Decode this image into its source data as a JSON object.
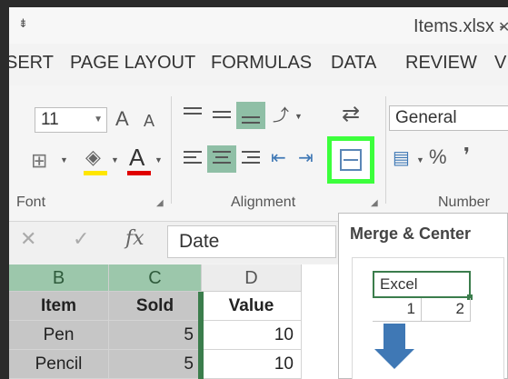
{
  "window": {
    "qat_glyph": "⇟",
    "title": "Items.xlsx - E",
    "close_glyph": "✕"
  },
  "tabs": [
    "SERT",
    "PAGE LAYOUT",
    "FORMULAS",
    "DATA",
    "REVIEW",
    "V"
  ],
  "font_group": {
    "size_value": "11",
    "increase_glyph": "A",
    "decrease_glyph": "A",
    "label": "Font",
    "fill_glyph": "◈",
    "font_color_glyph": "A",
    "highlight_color": "#ffe600",
    "font_color": "#e00000"
  },
  "alignment_group": {
    "label": "Alignment"
  },
  "number_group": {
    "format_value": "General",
    "percent_glyph": "%",
    "comma_glyph": "❜",
    "label": "Number"
  },
  "formula_bar": {
    "cancel_glyph": "✕",
    "enter_glyph": "✓",
    "fx_glyph": "fx",
    "value": "Date"
  },
  "grid": {
    "columns": [
      "B",
      "C",
      "D"
    ],
    "rows": [
      [
        "Item",
        "Sold",
        "Value"
      ],
      [
        "Pen",
        "5",
        "10"
      ],
      [
        "Pencil",
        "5",
        "10"
      ]
    ]
  },
  "tooltip": {
    "title": "Merge & Center",
    "example_text": "Excel",
    "example_cells": [
      "1",
      "2"
    ]
  },
  "colors": {
    "highlight_border": "#3cff3c",
    "selected_header": "#9cc7ab"
  }
}
